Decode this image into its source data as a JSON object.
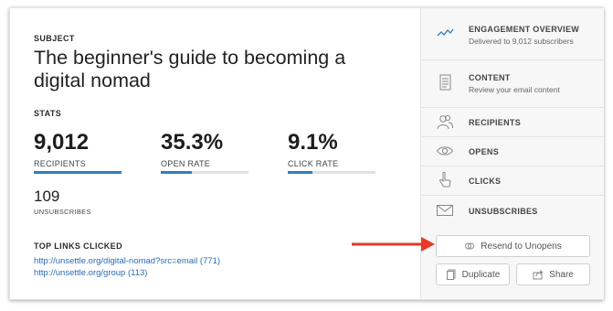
{
  "subject": {
    "label": "SUBJECT",
    "text": "The beginner's guide to becoming a digital nomad"
  },
  "stats": {
    "label": "STATS",
    "items": [
      {
        "value": "9,012",
        "caption": "RECIPIENTS",
        "fill": 1.0
      },
      {
        "value": "35.3%",
        "caption": "OPEN RATE",
        "fill": 0.353
      },
      {
        "value": "9.1%",
        "caption": "CLICK RATE",
        "fill": 0.28
      }
    ],
    "unsubscribes": {
      "value": "109",
      "caption": "UNSUBSCRIBES"
    }
  },
  "links": {
    "label": "TOP LINKS CLICKED",
    "items": [
      "http://unsettle.org/digital-nomad?src=email (771)",
      "http://unsettle.org/group (113)"
    ]
  },
  "menu": [
    {
      "icon": "line-chart-icon",
      "title": "ENGAGEMENT OVERVIEW",
      "subtitle": "Delivered to 9,012 subscribers"
    },
    {
      "icon": "document-icon",
      "title": "CONTENT",
      "subtitle": "Review your email content"
    },
    {
      "icon": "people-icon",
      "title": "RECIPIENTS",
      "subtitle": ""
    },
    {
      "icon": "eye-icon",
      "title": "OPENS",
      "subtitle": ""
    },
    {
      "icon": "pointer-hand-icon",
      "title": "CLICKS",
      "subtitle": ""
    },
    {
      "icon": "envelope-icon",
      "title": "UNSUBSCRIBES",
      "subtitle": ""
    }
  ],
  "actions": {
    "resend": "Resend to Unopens",
    "duplicate": "Duplicate",
    "share": "Share"
  },
  "colors": {
    "accent": "#2f7fc1",
    "arrow": "#e8382a",
    "link": "#2a6db2"
  }
}
